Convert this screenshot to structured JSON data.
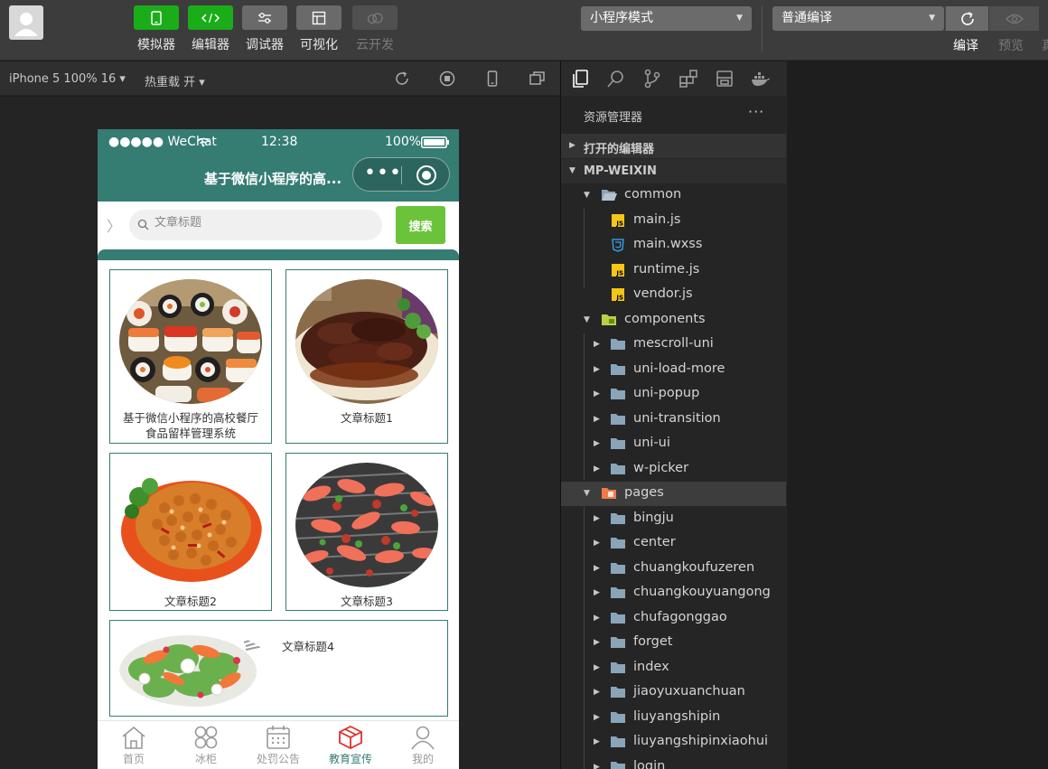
{
  "toolbar": {
    "tools": [
      {
        "label": "模拟器",
        "icon": "phone-icon"
      },
      {
        "label": "编辑器",
        "icon": "code-icon"
      },
      {
        "label": "调试器",
        "icon": "sliders-icon"
      },
      {
        "label": "可视化",
        "icon": "layout-icon"
      },
      {
        "label": "云开发",
        "icon": "cloud-icon"
      }
    ],
    "mode_select": "小程序模式",
    "compile_select": "普通编译",
    "compile_label": "编译",
    "preview_label": "预览",
    "extra_label": "真"
  },
  "simulator": {
    "device": "iPhone 5 100% 16 ▾",
    "hot_reload": "热重载 开 ▾"
  },
  "phone": {
    "status": {
      "carrier": "●●●●● WeChat",
      "time": "12:38",
      "battery": "100%"
    },
    "nav_title": "基于微信小程序的高...",
    "search": {
      "placeholder": "文章标题",
      "button": "搜索"
    },
    "cards": [
      {
        "title": "基于微信小程序的高校餐厅食品留样管理系统",
        "image": "sushi"
      },
      {
        "title": "文章标题1",
        "image": "braised-meat"
      },
      {
        "title": "文章标题2",
        "image": "chicken-peanuts"
      },
      {
        "title": "文章标题3",
        "image": "grilled-shrimp"
      },
      {
        "title": "文章标题4",
        "image": "salad"
      }
    ],
    "tabs": [
      {
        "label": "首页",
        "icon": "home-icon",
        "active": false
      },
      {
        "label": "冰柜",
        "icon": "grid-icon",
        "active": false
      },
      {
        "label": "处罚公告",
        "icon": "calendar-icon",
        "active": false
      },
      {
        "label": "教育宣传",
        "icon": "cube-icon",
        "active": true
      },
      {
        "label": "我的",
        "icon": "user-icon",
        "active": false
      }
    ]
  },
  "explorer": {
    "title": "资源管理器",
    "more": "···",
    "open_editors": "打开的编辑器",
    "project": "MP-WEIXIN",
    "items": [
      {
        "name": "common",
        "kind": "folder-open",
        "depth": 1,
        "expanded": true
      },
      {
        "name": "main.js",
        "kind": "js",
        "depth": 2
      },
      {
        "name": "main.wxss",
        "kind": "css",
        "depth": 2
      },
      {
        "name": "runtime.js",
        "kind": "js",
        "depth": 2
      },
      {
        "name": "vendor.js",
        "kind": "js",
        "depth": 2
      },
      {
        "name": "components",
        "kind": "folder-components",
        "depth": 1,
        "expanded": true
      },
      {
        "name": "mescroll-uni",
        "kind": "folder",
        "depth": 2
      },
      {
        "name": "uni-load-more",
        "kind": "folder",
        "depth": 2
      },
      {
        "name": "uni-popup",
        "kind": "folder",
        "depth": 2
      },
      {
        "name": "uni-transition",
        "kind": "folder",
        "depth": 2
      },
      {
        "name": "uni-ui",
        "kind": "folder",
        "depth": 2
      },
      {
        "name": "w-picker",
        "kind": "folder",
        "depth": 2
      },
      {
        "name": "pages",
        "kind": "folder-pages",
        "depth": 1,
        "expanded": true,
        "selected": true
      },
      {
        "name": "bingju",
        "kind": "folder",
        "depth": 2
      },
      {
        "name": "center",
        "kind": "folder",
        "depth": 2
      },
      {
        "name": "chuangkoufuzeren",
        "kind": "folder",
        "depth": 2
      },
      {
        "name": "chuangkouyuangong",
        "kind": "folder",
        "depth": 2
      },
      {
        "name": "chufagonggao",
        "kind": "folder",
        "depth": 2
      },
      {
        "name": "forget",
        "kind": "folder",
        "depth": 2
      },
      {
        "name": "index",
        "kind": "folder",
        "depth": 2
      },
      {
        "name": "jiaoyuxuanchuan",
        "kind": "folder",
        "depth": 2
      },
      {
        "name": "liuyangshipin",
        "kind": "folder",
        "depth": 2
      },
      {
        "name": "liuyangshipinxiaohui",
        "kind": "folder",
        "depth": 2
      },
      {
        "name": "login",
        "kind": "folder",
        "depth": 2
      }
    ]
  },
  "colors": {
    "theme": "#357c73",
    "search_button": "#6bc33a",
    "tool_green": "#1aad19"
  }
}
